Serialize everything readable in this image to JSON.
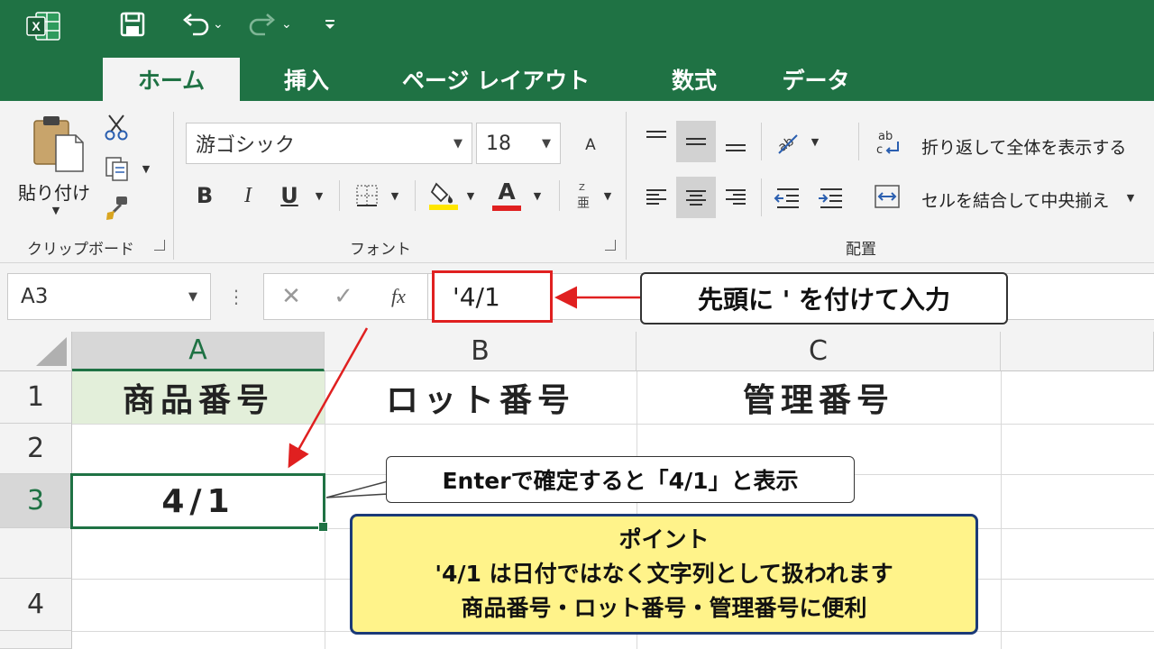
{
  "app": {
    "logo_letter": "X"
  },
  "tabs": [
    {
      "label": "ホーム",
      "active": true
    },
    {
      "label": "挿入"
    },
    {
      "label": "ページ レイアウト"
    },
    {
      "label": "数式"
    },
    {
      "label": "データ"
    }
  ],
  "ribbon": {
    "clipboard": {
      "paste_label": "貼り付け",
      "group_label": "クリップボード"
    },
    "font": {
      "font_name": "游ゴシック",
      "font_size": "18",
      "bold": "B",
      "italic": "I",
      "underline": "U",
      "font_color_letter": "A",
      "grow_font": "A",
      "group_label": "フォント",
      "highlight_color": "#ffe600",
      "font_color": "#e02020"
    },
    "alignment": {
      "wrap_text": "折り返して全体を表示する",
      "merge_center": "セルを結合して中央揃え",
      "group_label": "配置"
    }
  },
  "formula_bar": {
    "name_box": "A3",
    "fx": "fx",
    "value": "'4/1"
  },
  "sheet": {
    "columns": [
      "A",
      "B",
      "C"
    ],
    "rows": [
      "1",
      "2",
      "3",
      "4"
    ],
    "cells": {
      "A1": "商品番号",
      "B1": "ロット番号",
      "C1": "管理番号",
      "A3": "4/1"
    },
    "selected_cell": "A3"
  },
  "annotations": {
    "formula_callout": "先頭に ' を付けて入力",
    "cell_callout": "Enterで確定すると「4/1」と表示",
    "point_title": "ポイント",
    "point_line1": "'4/1 は日付ではなく文字列として扱われます",
    "point_line2": "商品番号・ロット番号・管理番号に便利"
  },
  "colors": {
    "excel_green": "#1f7244",
    "highlight_red": "#e02020",
    "point_bg": "#fff38a",
    "point_border": "#1b3a78",
    "header_fill": "#e3efda"
  }
}
